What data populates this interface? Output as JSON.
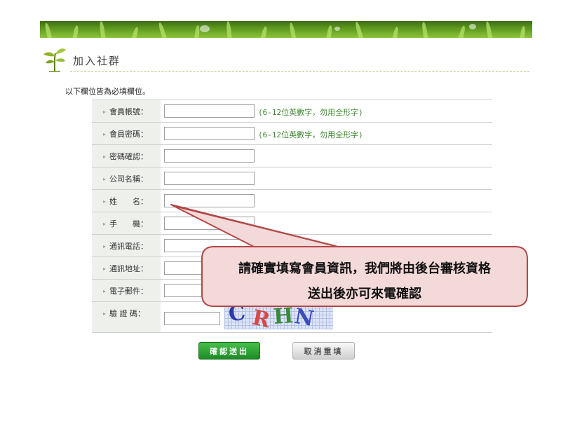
{
  "header": {
    "title": "加入社群",
    "intro": "以下欄位皆為必填欄位。"
  },
  "form": {
    "rows": [
      {
        "label": "會員帳號：",
        "hint": "(6-12位英數字，勿用全形字)"
      },
      {
        "label": "會員密碼：",
        "hint": "(6-12位英數字，勿用全形字)"
      },
      {
        "label": "密碼確認："
      },
      {
        "label": "公司名稱："
      },
      {
        "label": "姓　　名："
      },
      {
        "label": "手　　機："
      },
      {
        "label": "通訊電話："
      },
      {
        "label": "通訊地址："
      },
      {
        "label": "電子郵件："
      },
      {
        "label": "驗 證 碼："
      }
    ],
    "captcha": [
      "C",
      "R",
      "H",
      "N"
    ]
  },
  "buttons": {
    "submit": "確認送出",
    "reset": "取消重填"
  },
  "callout": {
    "line1": "請確實填寫會員資訊，我們將由後台審核資格",
    "line2": "送出後亦可來電確認"
  },
  "colors": {
    "hint_green": "#3e8a2e",
    "callout_fill": "#f4d9d9",
    "callout_border": "#b24848",
    "submit_green": "#2aa233",
    "captcha_colors": [
      "#2b3aa6",
      "#d44a4a",
      "#3a8a3a",
      "#3b4cc0"
    ]
  }
}
